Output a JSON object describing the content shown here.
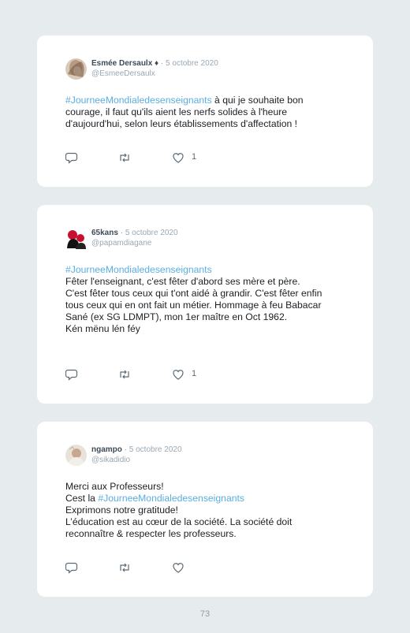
{
  "tweets": [
    {
      "name": "Esmée Dersaulx ♦",
      "sep": " · ",
      "date": "5 octobre 2020",
      "handle": "@EsmeeDersaulx",
      "hashtag": "#JourneeMondialedesenseignants",
      "text": " à qui je souhaite bon courage, il faut qu'ils aient les nerfs solides à l'heure d'aujourd'hui, selon leurs établissements d'affectation !",
      "likes": "1"
    },
    {
      "name": "65kans",
      "sep": " · ",
      "date": "5 octobre 2020",
      "handle": "@papamdiagane",
      "hashtag": "#JourneeMondialedesenseignants",
      "lines": [
        "Fêter l'enseignant, c'est fêter d'abord ses mère et père.",
        "C'est fêter tous ceux qui t'ont aidé à grandir. C'est fêter enfin tous ceux qui en ont fait un métier. Hommage à feu Babacar Sané (ex SG LDMPT), mon 1er maître en Oct 1962.",
        "Kén mënu lén féy"
      ],
      "likes": "1"
    },
    {
      "name": "ngampo",
      "sep": " · ",
      "date": "5 octobre 2020",
      "handle": "@sikadidio",
      "line1": "Merci aux Professeurs!",
      "line2_prefix": "Cest la ",
      "hashtag": "#JourneeMondialedesenseignants",
      "line3": "Exprimons notre gratitude!",
      "line4": "L’éducation est au cœur de la société. La société doit reconnaître & respecter les professeurs.",
      "likes": ""
    }
  ],
  "icons": {
    "reply": "reply-icon",
    "retweet": "retweet-icon",
    "like": "heart-icon"
  },
  "page_number": "73"
}
